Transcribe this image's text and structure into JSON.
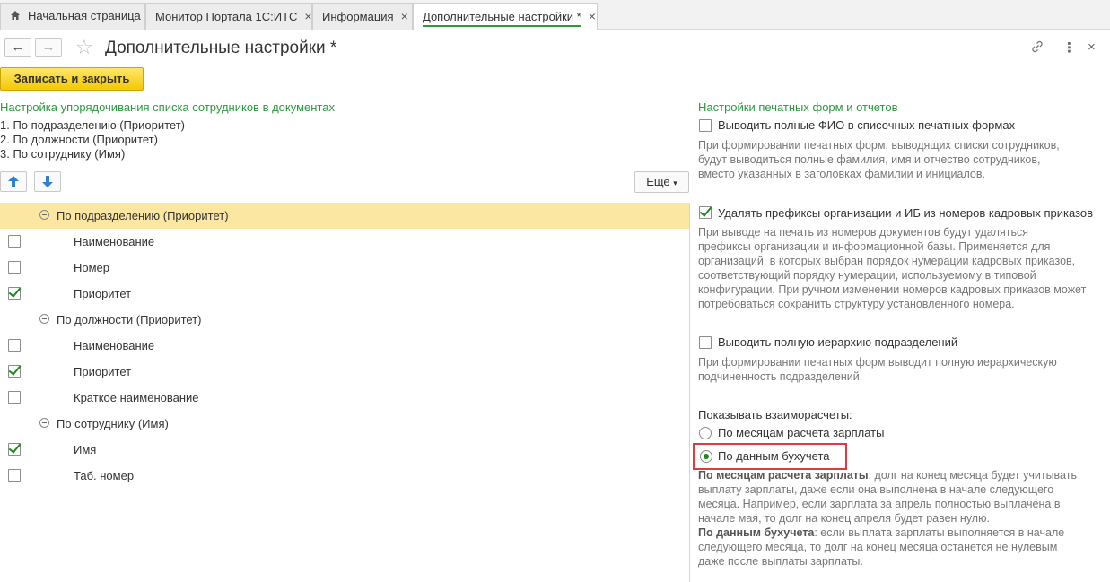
{
  "tabs": [
    {
      "label": "Начальная страница",
      "has_home_icon": true,
      "closable": false
    },
    {
      "label": "Монитор Портала 1С:ИТС",
      "closable": true
    },
    {
      "label": "Информация",
      "closable": true
    },
    {
      "label": "Дополнительные настройки *",
      "closable": true,
      "active": true
    }
  ],
  "header": {
    "title": "Дополнительные настройки *",
    "save_button": "Записать и закрыть"
  },
  "left": {
    "section_title": "Настройка упорядочивания списка сотрудников в документах",
    "order_lines": [
      "1. По подразделению (Приоритет)",
      "2. По должности (Приоритет)",
      "3. По сотруднику (Имя)"
    ],
    "more_button": "Еще",
    "tree": [
      {
        "type": "group",
        "label": "По подразделению (Приоритет)",
        "selected": true
      },
      {
        "type": "item",
        "label": "Наименование",
        "checked": false
      },
      {
        "type": "item",
        "label": "Номер",
        "checked": false
      },
      {
        "type": "item",
        "label": "Приоритет",
        "checked": true
      },
      {
        "type": "group",
        "label": "По должности (Приоритет)"
      },
      {
        "type": "item",
        "label": "Наименование",
        "checked": false
      },
      {
        "type": "item",
        "label": "Приоритет",
        "checked": true
      },
      {
        "type": "item",
        "label": "Краткое наименование",
        "checked": false
      },
      {
        "type": "group",
        "label": "По сотруднику (Имя)"
      },
      {
        "type": "item",
        "label": "Имя",
        "checked": true
      },
      {
        "type": "item",
        "label": "Таб. номер",
        "checked": false
      }
    ]
  },
  "right": {
    "section_title": "Настройки печатных форм и отчетов",
    "opt1": {
      "label": "Выводить полные ФИО в списочных печатных формах",
      "checked": false,
      "desc": [
        "При формировании печатных форм, выводящих списки сотрудников,",
        "будут выводиться полные фамилия, имя и отчество сотрудников,",
        "вместо указанных в заголовках фамилии и инициалов."
      ]
    },
    "opt2": {
      "label": "Удалять префиксы организации и ИБ из номеров кадровых приказов",
      "checked": true,
      "desc": [
        "При выводе на печать из номеров документов будут удаляться",
        "префиксы организации и информационной базы. Применяется для",
        "организаций, в которых выбран порядок нумерации кадровых приказов,",
        "соответствующий порядку нумерации, используемому в типовой",
        "конфигурации. При ручном изменении номеров кадровых приказов может",
        "потребоваться сохранить структуру установленного номера."
      ]
    },
    "opt3": {
      "label": "Выводить полную иерархию подразделений",
      "checked": false,
      "desc": [
        "При формировании печатных форм выводит полную иерархическую",
        "подчиненность подразделений."
      ]
    },
    "settlements_label": "Показывать взаиморасчеты:",
    "radio1": "По месяцам расчета зарплаты",
    "radio2": "По данным бухучета",
    "radio_selected": "radio2",
    "bottom": {
      "term1": "По месяцам расчета зарплаты",
      "text1_line1": ": долг на конец месяца будет учитывать",
      "text1_rest": [
        "выплату зарплаты, даже если она выполнена в начале следующего",
        "месяца. Например, если зарплата за апрель полностью выплачена в",
        "начале мая, то долг на конец апреля будет равен нулю."
      ],
      "term2": "По данным бухучета",
      "text2_line1": ": если выплата зарплаты выполняется в начале",
      "text2_rest": [
        "следующего месяца, то долг на конец месяца останется не нулевым",
        "даже после выплаты зарплаты."
      ]
    }
  },
  "colors": {
    "accent_green": "#2a9a3a",
    "save_yellow": "#f4c900",
    "selected_row": "#fbe6a2",
    "highlight_red": "#e0393f"
  }
}
